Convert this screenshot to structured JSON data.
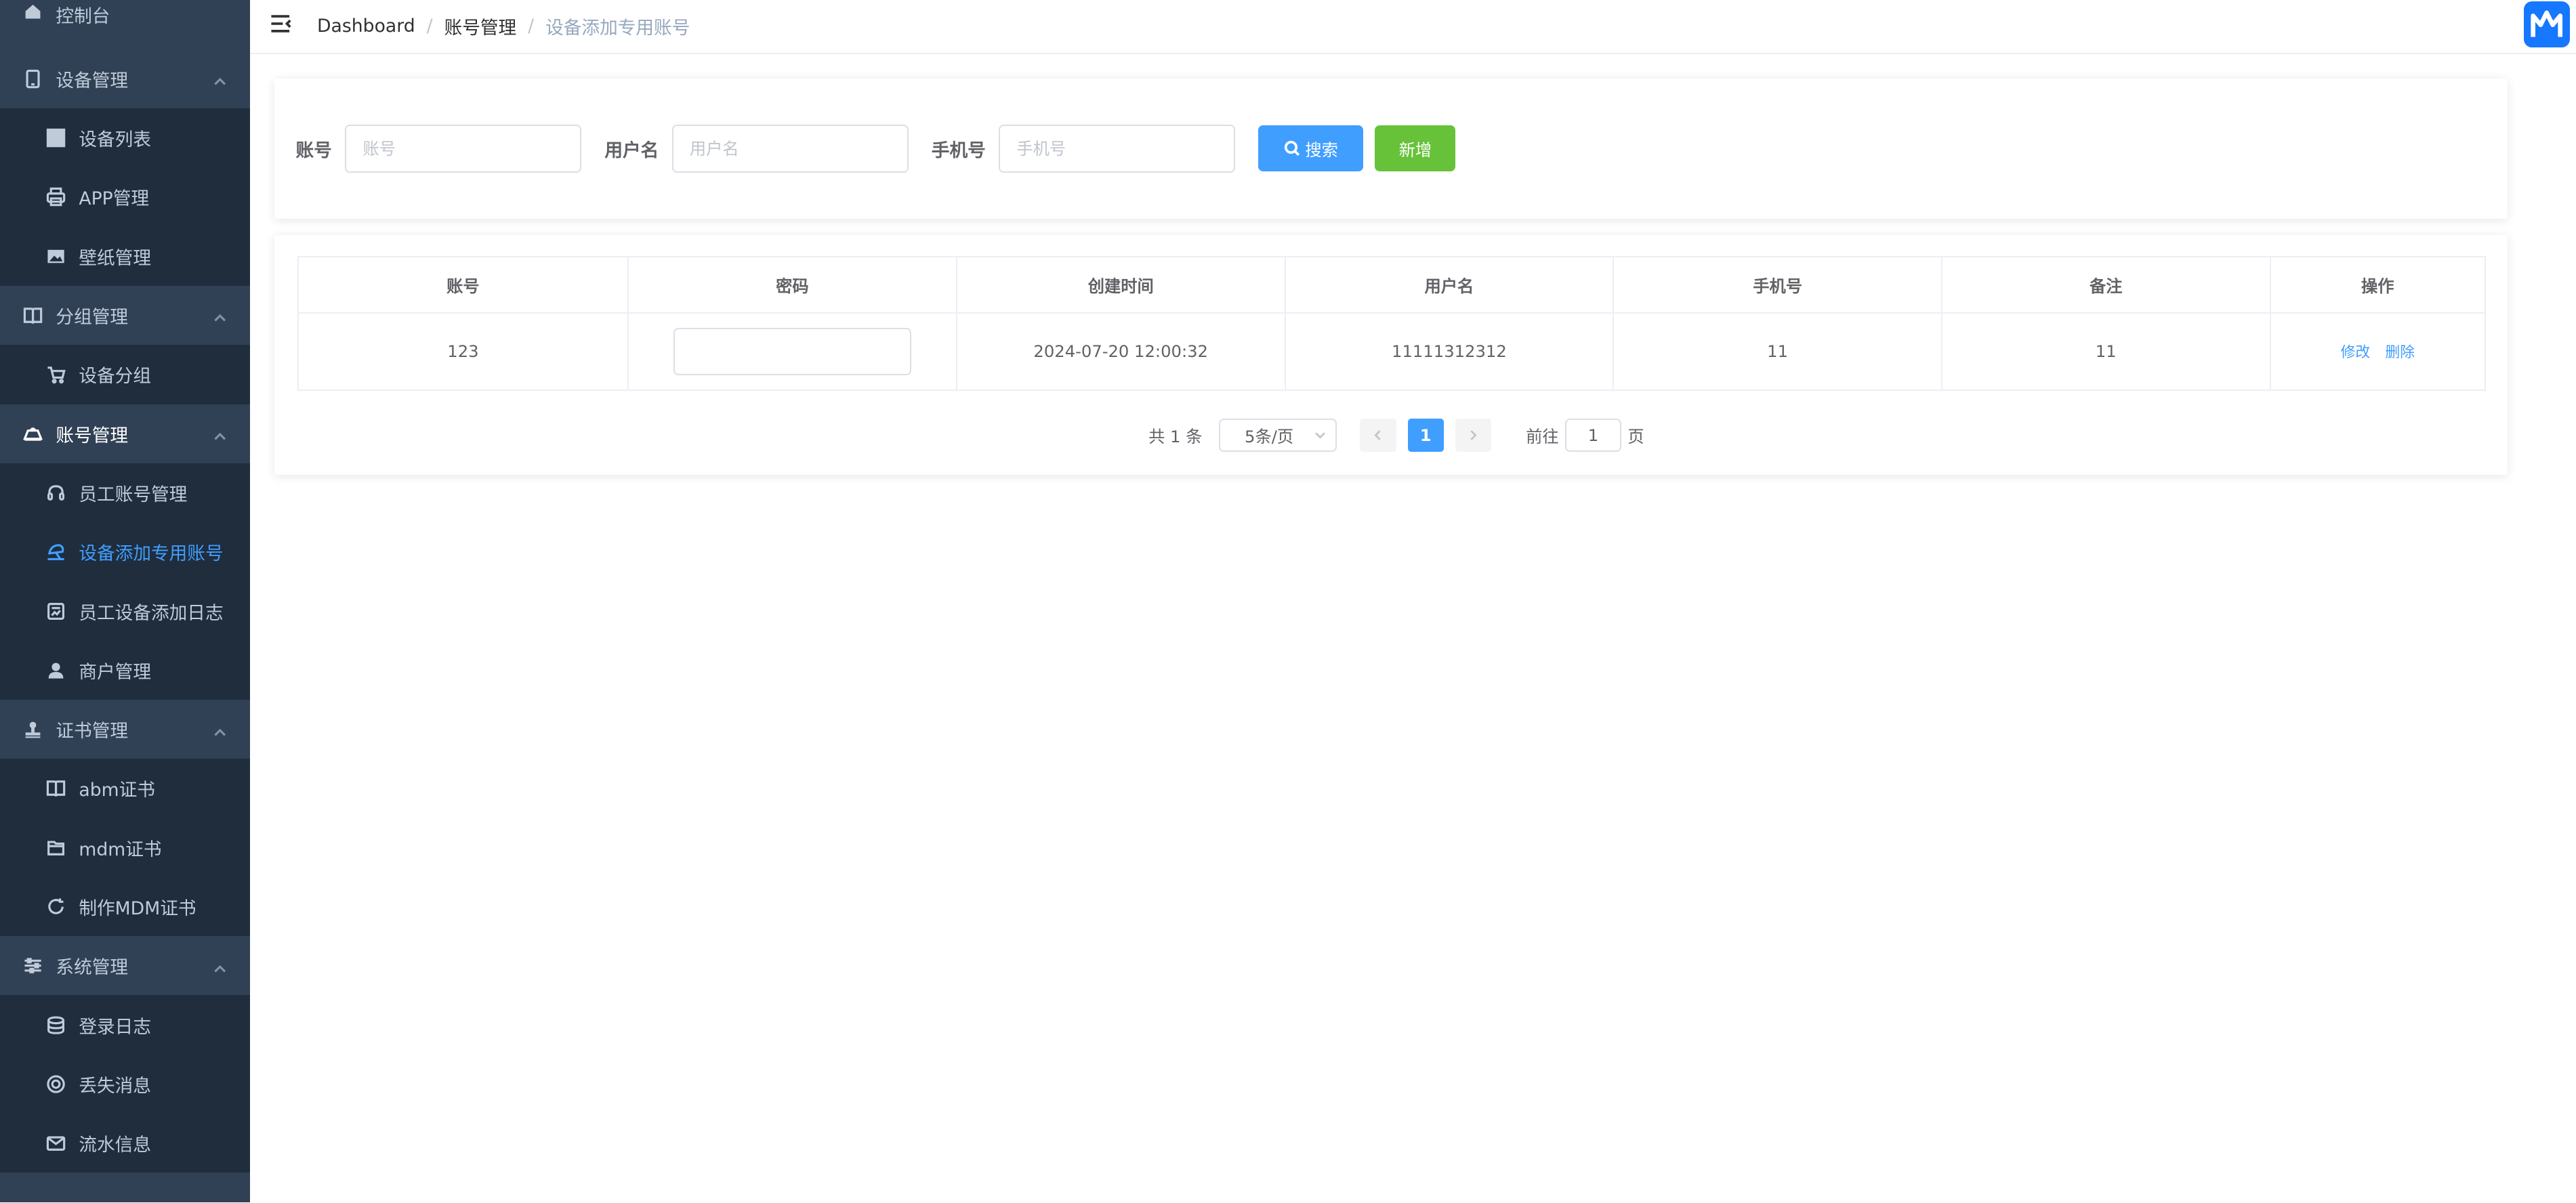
{
  "sidebar": {
    "items": [
      {
        "label": "控制台",
        "icon": "home-icon",
        "type": "group"
      },
      {
        "label": "设备管理",
        "icon": "tablet-icon",
        "type": "group"
      },
      {
        "label": "设备列表",
        "icon": "grid-icon",
        "type": "sub"
      },
      {
        "label": "APP管理",
        "icon": "printer-icon",
        "type": "sub"
      },
      {
        "label": "壁纸管理",
        "icon": "picture-icon",
        "type": "sub"
      },
      {
        "label": "分组管理",
        "icon": "book-icon",
        "type": "group"
      },
      {
        "label": "设备分组",
        "icon": "cart-icon",
        "type": "sub"
      },
      {
        "label": "账号管理",
        "icon": "house-icon",
        "type": "group"
      },
      {
        "label": "员工账号管理",
        "icon": "headset-icon",
        "type": "sub"
      },
      {
        "label": "设备添加专用账号",
        "icon": "ice-cream-icon",
        "type": "sub",
        "active": true
      },
      {
        "label": "员工设备添加日志",
        "icon": "data-board-icon",
        "type": "sub"
      },
      {
        "label": "商户管理",
        "icon": "user-icon",
        "type": "sub"
      },
      {
        "label": "证书管理",
        "icon": "stamp-icon",
        "type": "group"
      },
      {
        "label": "abm证书",
        "icon": "book-icon",
        "type": "sub"
      },
      {
        "label": "mdm证书",
        "icon": "folder-icon",
        "type": "sub"
      },
      {
        "label": "制作MDM证书",
        "icon": "refresh-icon",
        "type": "sub"
      },
      {
        "label": "系统管理",
        "icon": "sliders-icon",
        "type": "group"
      },
      {
        "label": "登录日志",
        "icon": "coin-icon",
        "type": "sub"
      },
      {
        "label": "丢失消息",
        "icon": "lifebuoy-icon",
        "type": "sub"
      },
      {
        "label": "流水信息",
        "icon": "message-icon",
        "type": "sub"
      }
    ]
  },
  "header": {
    "breadcrumb": [
      "Dashboard",
      "账号管理",
      "设备添加专用账号"
    ]
  },
  "search": {
    "account_label": "账号",
    "account_placeholder": "账号",
    "username_label": "用户名",
    "username_placeholder": "用户名",
    "phone_label": "手机号",
    "phone_placeholder": "手机号",
    "search_button": "搜索",
    "add_button": "新增"
  },
  "table": {
    "columns": [
      "账号",
      "密码",
      "创建时间",
      "用户名",
      "手机号",
      "备注",
      "操作"
    ],
    "rows": [
      {
        "account": "123",
        "password": "",
        "created": "2024-07-20 12:00:32",
        "username": "11111312312",
        "phone": "11",
        "remark": "11",
        "edit": "修改",
        "delete": "删除"
      }
    ]
  },
  "pagination": {
    "total": "共 1 条",
    "page_size": "5条/页",
    "current_page": "1",
    "goto_prefix": "前往",
    "goto_value": "1",
    "goto_suffix": "页"
  },
  "colors": {
    "sidebar_bg": "#304156",
    "submenu_bg": "#1f2d3d",
    "accent": "#409eff",
    "add_green": "#67c23a"
  }
}
